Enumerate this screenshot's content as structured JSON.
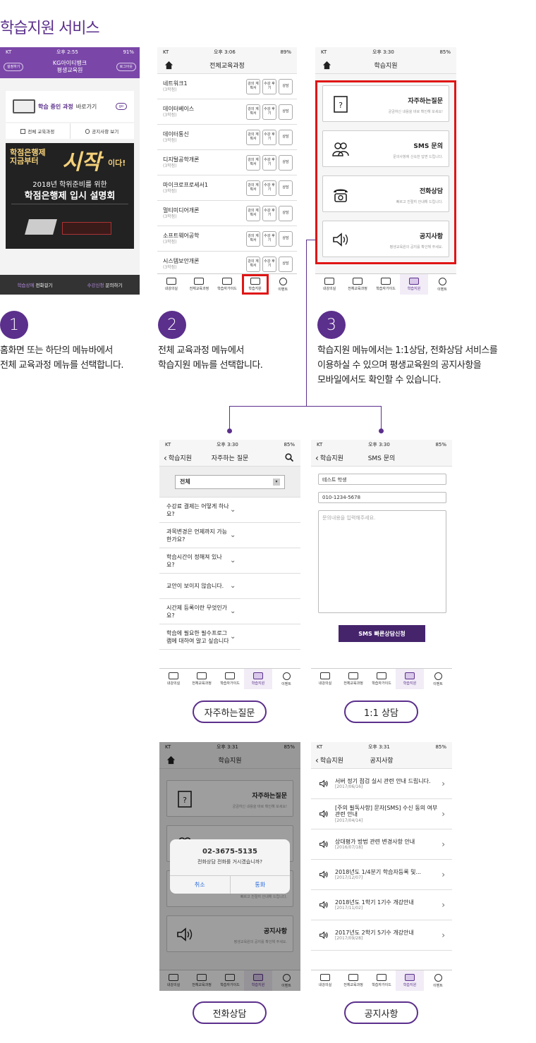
{
  "page_title": "학습지원 서비스",
  "status": {
    "carrier": "KT",
    "battery": "91%",
    "battery2": "89%",
    "battery3": "85%",
    "time1": "오후 2:55",
    "time2": "오후 3:06",
    "time3": "오후 3:30",
    "time4": "오후 3:31"
  },
  "screen1": {
    "settings": "설정하기",
    "brand_line1": "KG아이티뱅크",
    "brand_line2": "평생교육원",
    "logout": "로그아웃",
    "learning_prefix": "학습 중인 과정",
    "learning_suffix": "바로가기",
    "go": "go",
    "menu_courses": "전체 교육과정",
    "menu_notice": "공지사항 보기",
    "banner_line1": "학점은행제",
    "banner_line2": "지금부터",
    "banner_big": "시작",
    "banner_big_suffix": "이다!",
    "banner_sub1": "2018년 학위준비를 위한",
    "banner_sub2": "학점은행제 입시 설명회",
    "bottom_left_a": "학습상에",
    "bottom_left_b": "전화걸기",
    "bottom_right_a": "수강신청",
    "bottom_right_b": "문의하기"
  },
  "screen2": {
    "title": "전체교육과정",
    "btn_plan": "강의 계획서",
    "btn_review": "수강 후기",
    "btn_consult": "상담",
    "courses": [
      {
        "name": "네트워크1",
        "credit": "(3학점)"
      },
      {
        "name": "데이터베이스",
        "credit": "(3학점)"
      },
      {
        "name": "데이터통신",
        "credit": "(3학점)"
      },
      {
        "name": "디지털공학개론",
        "credit": "(3학점)"
      },
      {
        "name": "마이크로프로세서1",
        "credit": "(3학점)"
      },
      {
        "name": "멀티미디어개론",
        "credit": "(3학점)"
      },
      {
        "name": "소프트웨어공학",
        "credit": "(3학점)"
      },
      {
        "name": "시스템보안개론",
        "credit": "(3학점)"
      }
    ]
  },
  "tabs": [
    "내강의실",
    "전체교육과정",
    "학습자가이드",
    "학습지원",
    "이벤트"
  ],
  "screen3": {
    "title": "학습지원",
    "cards": [
      {
        "title": "자주하는질문",
        "sub": "궁금하신 내용을 바로 확인해 보세요!"
      },
      {
        "title": "SMS 문의",
        "sub": "문의사항에 신속한 답변 드립니다."
      },
      {
        "title": "전화상담",
        "sub": "빠르고 친절히 안내해 드립니다."
      },
      {
        "title": "공지사항",
        "sub": "평생교육원의 공지를 확인해 주세요."
      }
    ]
  },
  "steps": [
    {
      "num": "1",
      "text1": "홈화면 또는 하단의 메뉴바에서",
      "text2": "전체 교육과정 메뉴를 선택합니다."
    },
    {
      "num": "2",
      "text1": "전체 교육과정 메뉴에서",
      "text2": "학습지원 메뉴를 선택합니다."
    },
    {
      "num": "3",
      "text1": "학습지원 메뉴에서는 1:1상담, 전화상담 서비스를",
      "text2": "이용하실 수 있으며 평생교육원의 공지사항을",
      "text3": "모바일에서도 확인할 수 있습니다."
    }
  ],
  "faq": {
    "back": "학습지원",
    "title": "자주하는 질문",
    "select": "전체",
    "items": [
      "수강료 결제는 어떻게 하나요?",
      "과목변경은 언제까지 가능한가요?",
      "학습시간이 정해져 있나요?",
      "교안이 보이지 않습니다.",
      "시간제 등록이란 무엇인가요?",
      "학습에 필요한 필수프로그램에 대하여 알고 싶습니다"
    ],
    "label": "자주하는질문"
  },
  "sms": {
    "back": "학습지원",
    "title": "SMS 문의",
    "name_value": "테스트 학생",
    "phone_value": "010-1234-5678",
    "msg_placeholder": "문의내용을 입력해주세요.",
    "submit": "SMS 빠른상담신청",
    "label": "1:1 상담"
  },
  "phone_call": {
    "title": "학습지원",
    "number": "02-3675-5135",
    "question": "전화상담 전화를 거시겠습니까?",
    "cancel": "취소",
    "call": "통화",
    "label": "전화상담"
  },
  "notice": {
    "back": "학습지원",
    "title": "공지사항",
    "items": [
      {
        "title": "서버 정기 점검 실시 관련 안내 드립니다.",
        "date": "[2017/06/16]"
      },
      {
        "title": "[주의 필독사항] 문자[SMS] 수신 동의 여부 관련 안내",
        "date": "[2017/04/14]"
      },
      {
        "title": "상대평가 방법 관련 변경사항 안내",
        "date": "[2016/07/18]"
      },
      {
        "title": "2018년도 1/4분기 학습자등록 및...",
        "date": "[2017/12/07]"
      },
      {
        "title": "2018년도 1학기 1기수 개강안내",
        "date": "[2017/11/02]"
      },
      {
        "title": "2017년도 2학기 5기수 개강안내",
        "date": "[2017/09/28]"
      }
    ],
    "label": "공지사항"
  }
}
